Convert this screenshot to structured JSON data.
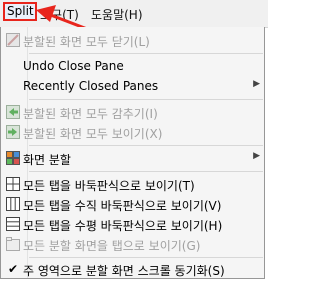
{
  "menubar": {
    "split": "Split",
    "tools": "도구(T)",
    "help": "도움말(H)"
  },
  "menu": {
    "items": [
      {
        "label": "분할된 화면 모두 닫기(L)",
        "enabled": false
      },
      {
        "label": "Undo Close Pane",
        "enabled": true
      },
      {
        "label": "Recently Closed Panes",
        "enabled": true,
        "submenu": true
      },
      {
        "label": "분할된 화면 모두 감추기(I)",
        "enabled": false
      },
      {
        "label": "분할된 화면 모두 보이기(X)",
        "enabled": false
      },
      {
        "label": "화면 분할",
        "enabled": true,
        "submenu": true
      },
      {
        "label": "모든 탭을 바둑판식으로 보이기(T)",
        "enabled": true
      },
      {
        "label": "모든 탭을 수직 바둑판식으로 보이기(V)",
        "enabled": true
      },
      {
        "label": "모든 탭을 수평 바둑판식으로 보이기(H)",
        "enabled": true
      },
      {
        "label": "모든 분할 화면을 탭으로 보이기(G)",
        "enabled": false
      },
      {
        "label": "주 영역으로 분할 화면 스크롤 동기화(S)",
        "enabled": true,
        "checked": true
      }
    ]
  },
  "colors": {
    "highlight_box": "#e8251c",
    "menu_bg": "#f5f5f5",
    "disabled_text": "#a0a0a0"
  },
  "icons": {
    "close_all": "close-split-icon",
    "hide_all": "hide-panes-icon",
    "show_all": "show-panes-icon",
    "split_screen": "split-screen-icon",
    "tile": "tile-grid-icon",
    "tile_vertical": "tile-vertical-icon",
    "tile_horizontal": "tile-horizontal-icon",
    "as_tabs": "panes-to-tabs-icon",
    "sync": "checkmark-icon"
  }
}
